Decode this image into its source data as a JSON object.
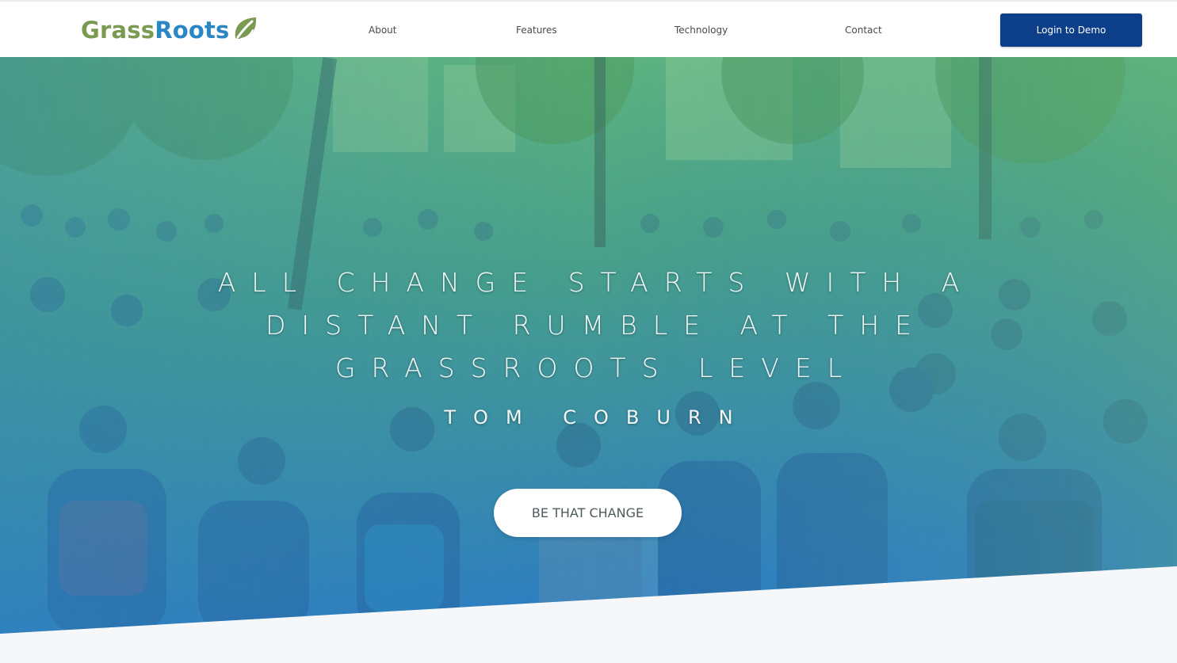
{
  "colors": {
    "brand_green": "#7a9a52",
    "brand_blue": "#2b87c4",
    "login_button_bg": "#0c3e8a",
    "hero_overlay_top": "#5fb67a",
    "hero_overlay_bottom": "#2f7fc0"
  },
  "brand": {
    "name_part1": "Grass",
    "name_part2": "Roots",
    "logo_icon": "leaf-icon"
  },
  "nav": {
    "links": [
      {
        "label": "About"
      },
      {
        "label": "Features"
      },
      {
        "label": "Technology"
      },
      {
        "label": "Contact"
      }
    ],
    "login_label": "Login to Demo"
  },
  "hero": {
    "background": "photo of a large crowd of protesters sitting in a park with a green-to-blue gradient overlay",
    "quote_lines": [
      "ALL CHANGE STARTS WITH A",
      "DISTANT RUMBLE AT THE",
      "GRASSROOTS LEVEL"
    ],
    "author": "TOM COBURN",
    "cta_label": "BE THAT CHANGE"
  }
}
